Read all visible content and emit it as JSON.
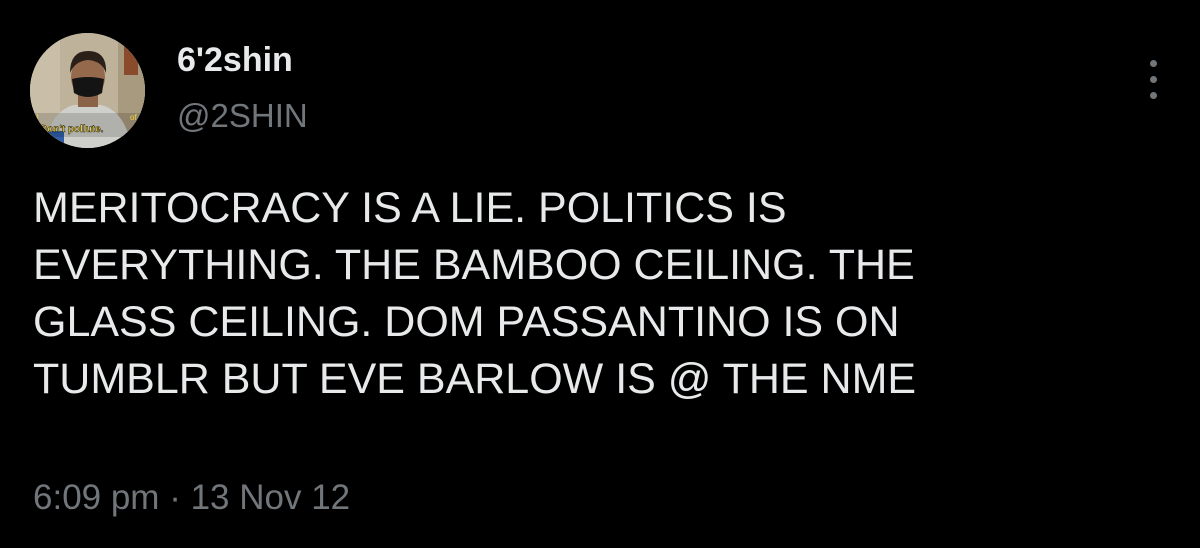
{
  "author": {
    "display_name": "6'2shin",
    "handle": "@2SHIN",
    "avatar": {
      "caption": "Don't pollute.",
      "caption_fragment_left": "al",
      "caption_fragment_right": "of"
    }
  },
  "menu": {
    "icon": "more-vertical-icon"
  },
  "tweet": {
    "lines": [
      "MERITOCRACY IS A LIE. POLITICS IS",
      "EVERYTHING. THE BAMBOO CEILING. THE",
      "GLASS CEILING. DOM PASSANTINO IS ON",
      "TUMBLR BUT EVE BARLOW IS @ THE NME"
    ],
    "time": "6:09 pm",
    "separator": "·",
    "date": "13 Nov 12"
  },
  "colors": {
    "background": "#000000",
    "text_primary": "#e7e9ea",
    "text_secondary": "#71767b",
    "caption_yellow": "#f1d23a"
  }
}
